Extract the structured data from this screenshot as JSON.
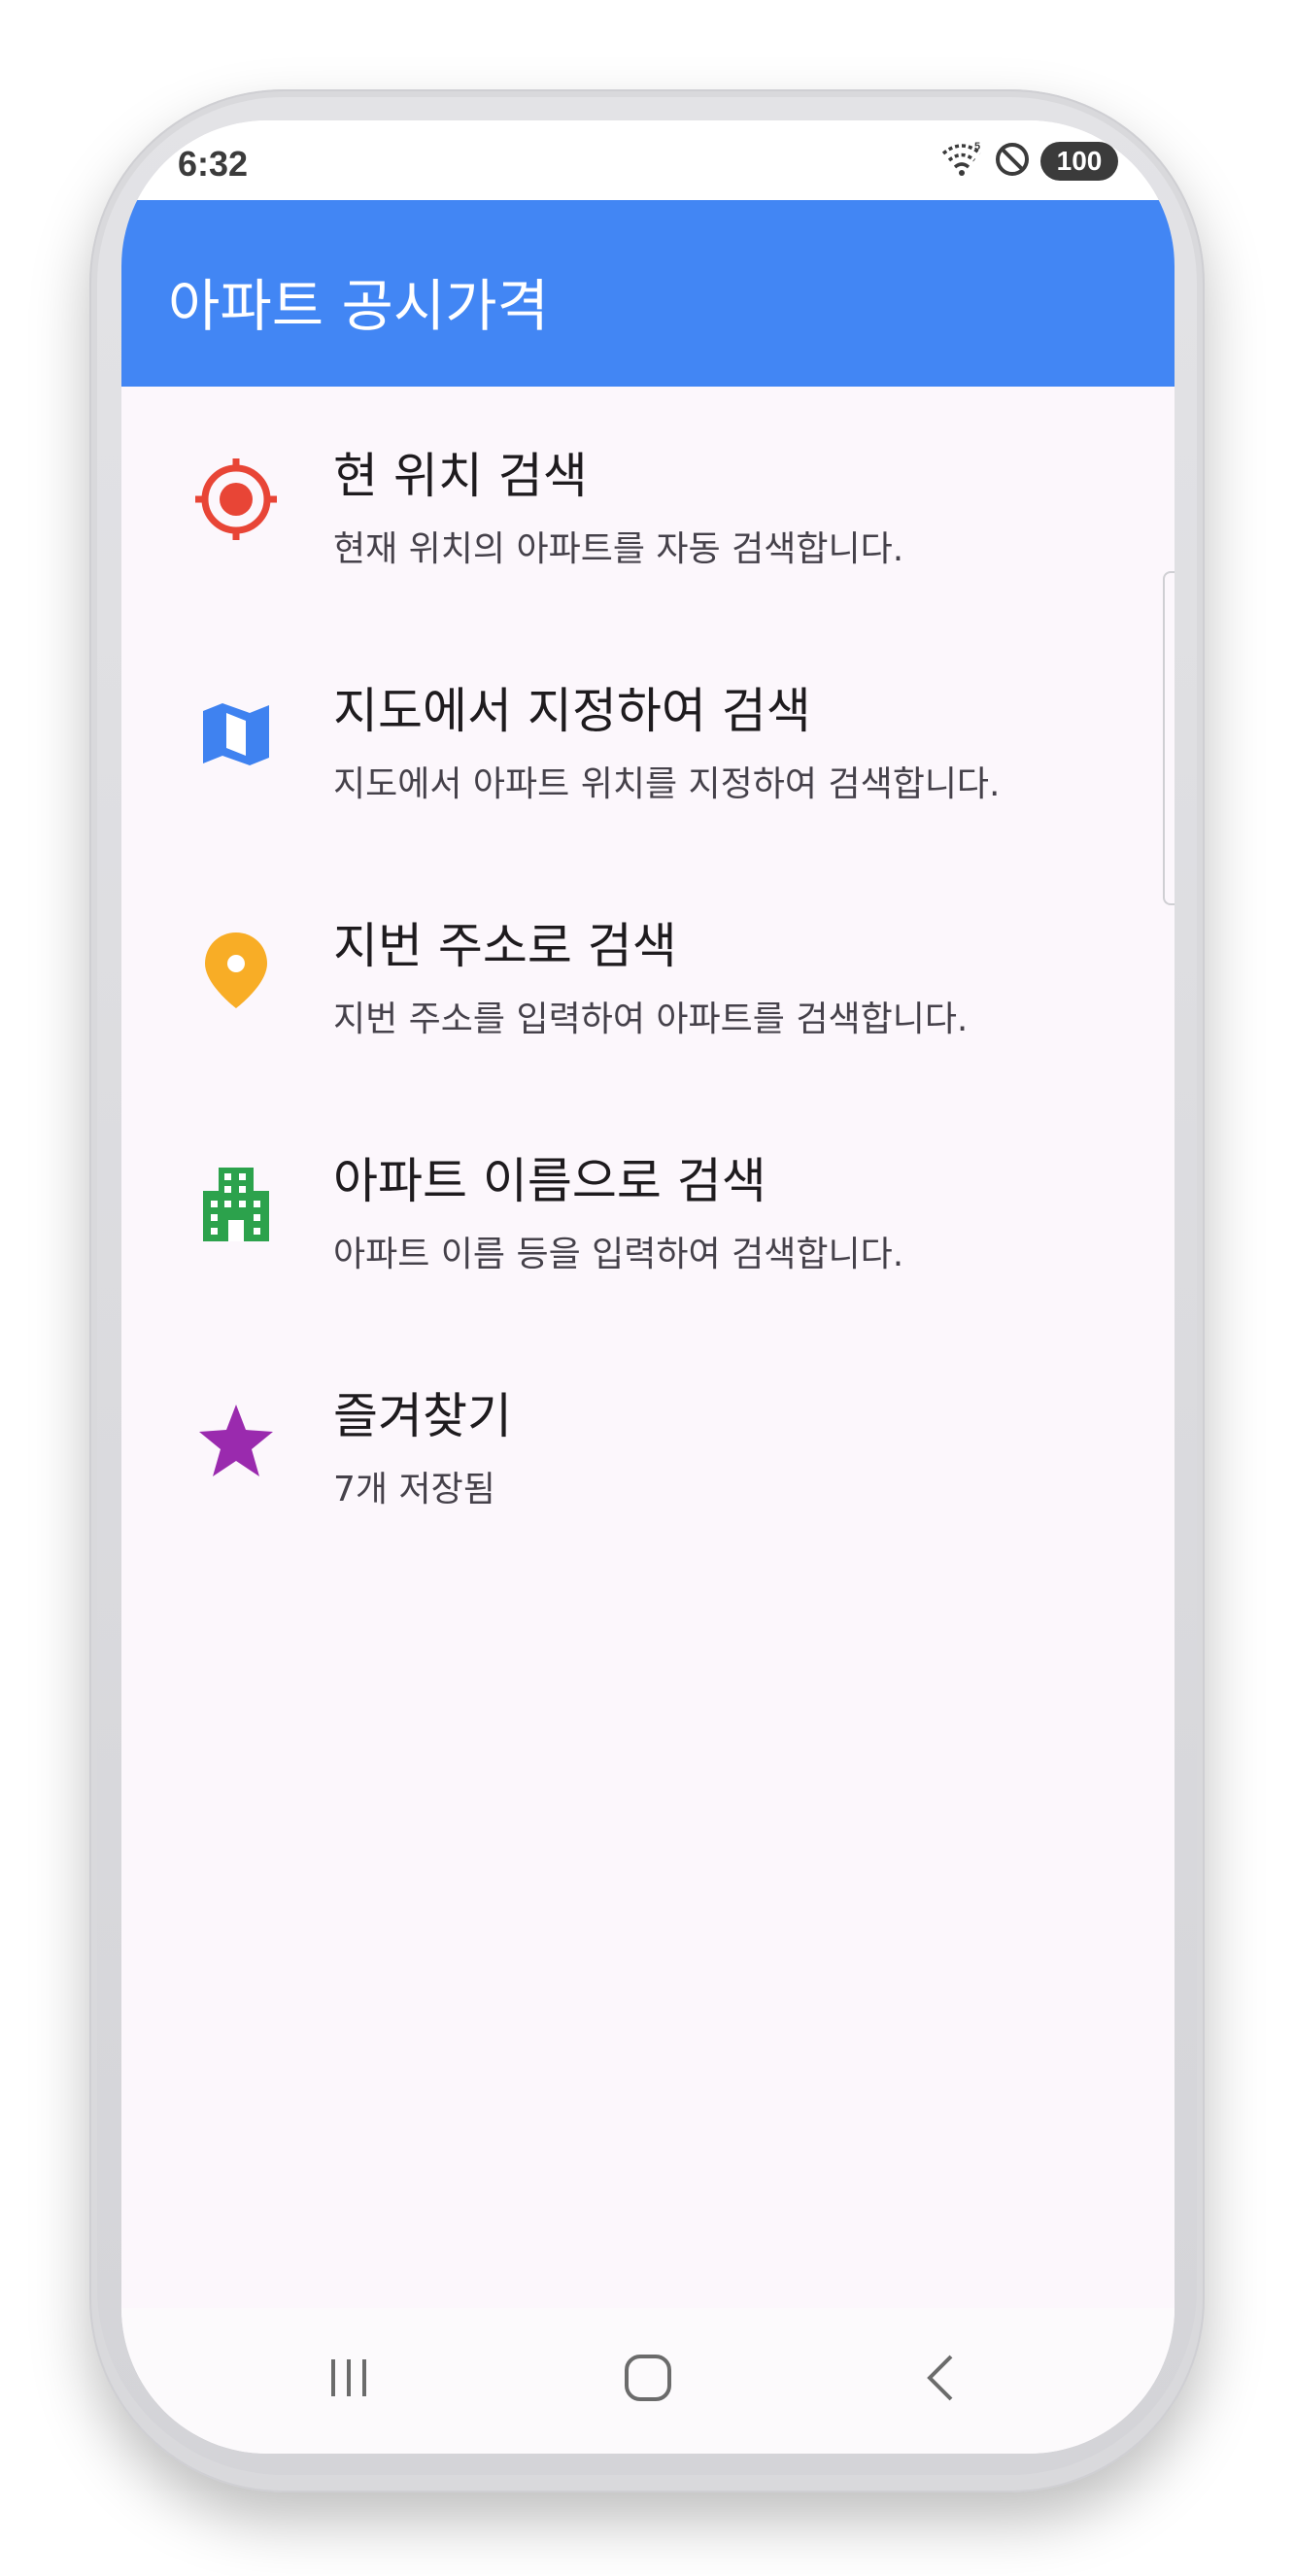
{
  "status_bar": {
    "time": "6:32",
    "battery": "100",
    "icons": [
      "wifi-icon",
      "do-not-disturb-icon",
      "battery-icon"
    ]
  },
  "app_bar": {
    "title": "아파트 공시가격",
    "color": "#4286f4"
  },
  "menu": {
    "items": [
      {
        "title": "현 위치 검색",
        "subtitle": "현재 위치의 아파트를 자동 검색합니다.",
        "icon": "location-target-icon",
        "icon_color": "#e84536"
      },
      {
        "title": "지도에서 지정하여 검색",
        "subtitle": "지도에서 아파트 위치를 지정하여 검색합니다.",
        "icon": "map-icon",
        "icon_color": "#3f82f0"
      },
      {
        "title": "지번 주소로 검색",
        "subtitle": "지번 주소를 입력하여 아파트를 검색합니다.",
        "icon": "map-pin-icon",
        "icon_color": "#f8ad26"
      },
      {
        "title": "아파트 이름으로 검색",
        "subtitle": "아파트 이름 등을 입력하여 검색합니다.",
        "icon": "building-icon",
        "icon_color": "#2ca24c"
      },
      {
        "title": "즐겨찾기",
        "subtitle": "7개 저장됨",
        "icon": "star-icon",
        "icon_color": "#9a2aae"
      }
    ]
  },
  "nav_bar": {
    "buttons": [
      "recent-apps-icon",
      "home-icon",
      "back-icon"
    ]
  }
}
